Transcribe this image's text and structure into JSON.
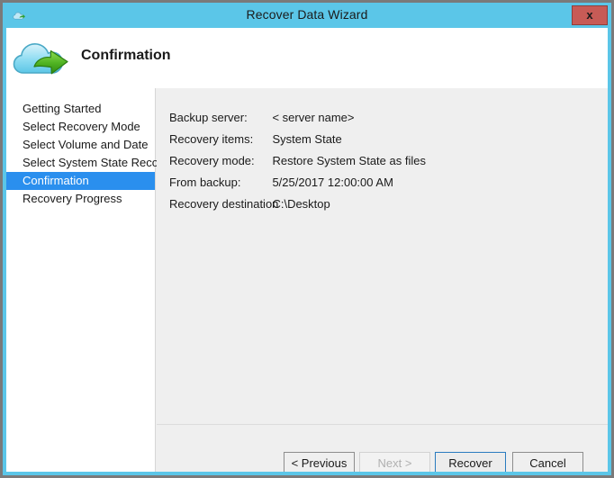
{
  "window": {
    "title": "Recover Data Wizard",
    "title_icon": "cloud-recover-icon",
    "close_label": "x"
  },
  "header": {
    "page_title": "Confirmation",
    "icon": "cloud-with-green-arrow-icon"
  },
  "sidebar": {
    "items": [
      {
        "label": "Getting Started",
        "current": false
      },
      {
        "label": "Select Recovery Mode",
        "current": false
      },
      {
        "label": "Select Volume and Date",
        "current": false
      },
      {
        "label": "Select System State Reco...",
        "current": false
      },
      {
        "label": "Confirmation",
        "current": true
      },
      {
        "label": "Recovery Progress",
        "current": false
      }
    ],
    "highlight_color": "#2a8fee"
  },
  "content": {
    "fields": [
      {
        "label": "Backup server:",
        "value": "< server name>"
      },
      {
        "label": "Recovery items:",
        "value": "System State"
      },
      {
        "label": "Recovery mode:",
        "value": "Restore System State as files"
      },
      {
        "label": "From backup:",
        "value": "5/25/2017 12:00:00 AM"
      },
      {
        "label": "Recovery destination",
        "value": "C:\\Desktop"
      }
    ]
  },
  "buttons": {
    "previous": "< Previous",
    "next": "Next >",
    "recover": "Recover",
    "cancel": "Cancel"
  }
}
